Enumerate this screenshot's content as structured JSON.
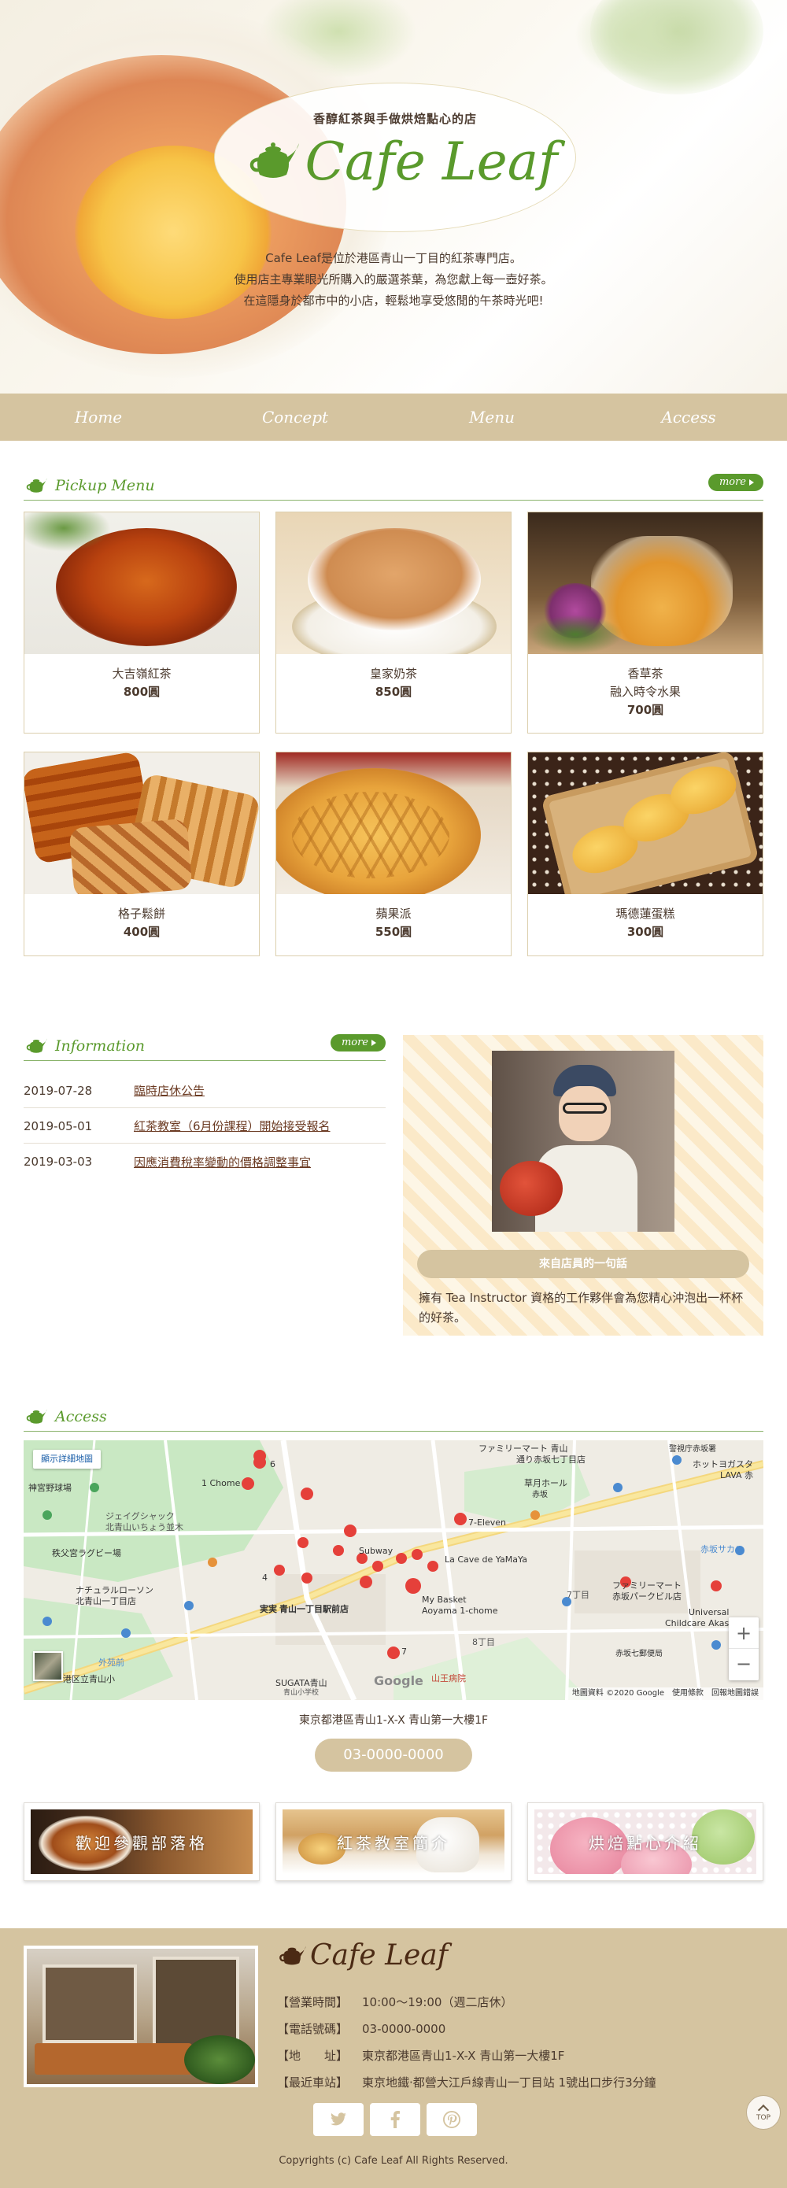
{
  "hero": {
    "tagline": "香醇紅茶與手做烘焙點心的店",
    "logo_text": "Cafe Leaf",
    "intro_lines": [
      "Cafe Leaf是位於港區青山一丁目的紅茶專門店。",
      "使用店主專業眼光所購入的嚴選茶葉，為您獻上每一壺好茶。",
      "在這隱身於都市中的小店，輕鬆地享受悠閒的午茶時光吧!"
    ]
  },
  "nav": {
    "items": [
      "Home",
      "Concept",
      "Menu",
      "Access"
    ]
  },
  "pickup": {
    "title": "Pickup Menu",
    "more": "more",
    "items": [
      {
        "name": "大吉嶺紅茶",
        "price": "800圓"
      },
      {
        "name": "皇家奶茶",
        "price": "850圓"
      },
      {
        "name": "香草茶",
        "subname": "融入時令水果",
        "price": "700圓"
      },
      {
        "name": "格子鬆餅",
        "price": "400圓"
      },
      {
        "name": "蘋果派",
        "price": "550圓"
      },
      {
        "name": "瑪德蓮蛋糕",
        "price": "300圓"
      }
    ]
  },
  "information": {
    "title": "Information",
    "more": "more",
    "news": [
      {
        "date": "2019-07-28",
        "text": "臨時店休公告"
      },
      {
        "date": "2019-05-01",
        "text": "紅茶教室（6月份課程）開始接受報名"
      },
      {
        "date": "2019-03-03",
        "text": "因應消費稅率變動的價格調整事宜"
      }
    ],
    "staff_label": "來自店員的一句話",
    "staff_text": "擁有 Tea Instructor 資格的工作夥伴會為您精心沖泡出一杯杯的好茶。"
  },
  "access": {
    "title": "Access",
    "map": {
      "detail_button": "顯示詳細地圖",
      "zoom_in": "+",
      "zoom_out": "−",
      "attribution": "地圖資料 ©2020 Google　使用條款　回報地圖錯誤",
      "google": "Google",
      "labels": {
        "family_mart_top": "ファミリーマート 青山",
        "family_mart_top2": "通り赤坂七丁目店",
        "keisatsu": "警視庁赤坂署",
        "hotto": "ホットヨガスタ",
        "lava": "LAVA 赤",
        "sogetsu": "草月ホール",
        "sogetsu2": "赤坂",
        "one_chome": "1 Chome",
        "num6": "6",
        "jingu": "神宮野球場",
        "seven": "7-Eleven",
        "geishaku": "ジェイグシャック",
        "geishaku2": "北青山いちょう並木",
        "chichibu": "秩父宮ラグビー場",
        "subway": "Subway",
        "cave": "La Cave de YaMaYa",
        "akasaka_sacas": "赤坂サカス",
        "natural": "ナチュラルローソン",
        "natural2": "北青山一丁目店",
        "aoyama_station": "青山一丁目駅前店",
        "lawson_label": "実実",
        "mybasket": "My Basket",
        "mybasket2": "Aoyama 1-chome",
        "family2": "ファミリーマート",
        "family2b": "赤坂パークビル店",
        "universal": "Universal",
        "universal2": "Childcare Akasaka",
        "gaien": "外苑前",
        "hachome": "8丁目",
        "nanachome": "7丁目",
        "akasaka7": "赤坂七郵便局",
        "aoyama_school": "港区立青山小",
        "sugata": "SUGATA青山",
        "aoyama_gakuin": "青山小学校",
        "sanno": "山王病院",
        "num4": "4",
        "num7": "7"
      }
    },
    "address": "東京都港區青山1-X-X 青山第一大樓1F",
    "phone": "03-0000-0000"
  },
  "banners": [
    {
      "label": "歡迎參觀部落格"
    },
    {
      "label": "紅茶教室簡介"
    },
    {
      "label": "烘焙點心介紹"
    }
  ],
  "footer": {
    "logo_text": "Cafe Leaf",
    "info": [
      {
        "key": "【營業時間】",
        "value": "10:00～19:00（週二店休）"
      },
      {
        "key": "【電話號碼】",
        "value": "03-0000-0000"
      },
      {
        "key": "【地　　址】",
        "value": "東京都港區青山1-X-X 青山第一大樓1F"
      },
      {
        "key": "【最近車站】",
        "value": "東京地鐵·都營大江戶線青山一丁目站 1號出口步行3分鐘"
      }
    ],
    "social": [
      "twitter-icon",
      "facebook-icon",
      "pinterest-icon"
    ],
    "copyright": "Copyrights (c) Cafe Leaf All Rights Reserved.",
    "top_label": "TOP"
  },
  "colors": {
    "accent_green": "#5a9a2c",
    "beige": "#d5c4a0",
    "text": "#4b3a2e"
  }
}
